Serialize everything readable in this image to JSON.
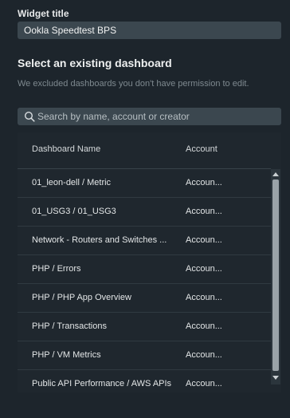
{
  "widget": {
    "label": "Widget title",
    "value": "Ookla Speedtest BPS"
  },
  "dashboard_section": {
    "title": "Select an existing dashboard",
    "note": "We excluded dashboards you don't have permission to edit."
  },
  "search": {
    "placeholder": "Search by name, account or creator",
    "icon": "search-icon"
  },
  "table": {
    "columns": [
      "Dashboard Name",
      "Account"
    ],
    "rows": [
      {
        "name": "01_leon-dell / Metric",
        "account": "Accoun..."
      },
      {
        "name": "01_USG3 / 01_USG3",
        "account": "Accoun..."
      },
      {
        "name": "Network - Routers and Switches ...",
        "account": "Accoun..."
      },
      {
        "name": "PHP / Errors",
        "account": "Accoun..."
      },
      {
        "name": "PHP / PHP App Overview",
        "account": "Accoun..."
      },
      {
        "name": "PHP / Transactions",
        "account": "Accoun..."
      },
      {
        "name": "PHP / VM Metrics",
        "account": "Accoun..."
      },
      {
        "name": "Public API Performance / AWS APIs",
        "account": "Accoun..."
      }
    ]
  }
}
